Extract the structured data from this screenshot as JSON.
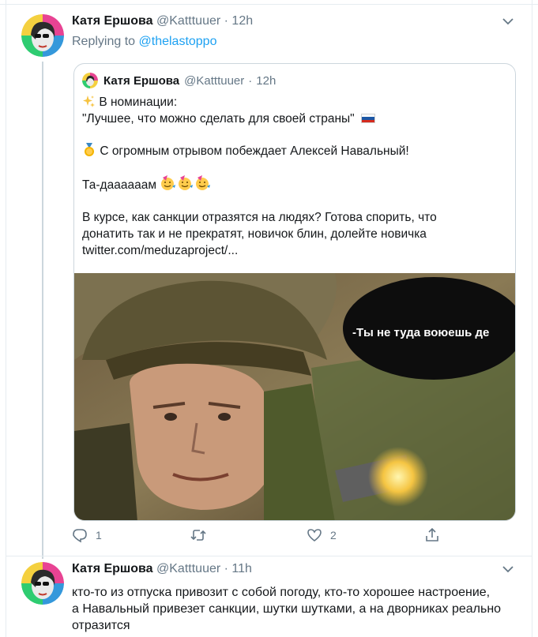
{
  "tweet1": {
    "author_name": "Катя Ершова",
    "author_handle": "@Katttuuer",
    "time": "12h",
    "replying_prefix": "Replying to",
    "replying_handle": "@thelastoppo",
    "quote": {
      "author_name": "Катя Ершова",
      "author_handle": "@Katttuuer",
      "time": "12h",
      "line1": "В номинации:",
      "line2": "\"Лучшее, что можно сделать для своей страны\"",
      "line3": "С огромным отрывом побеждает Алексей Навальный!",
      "line4": "Та-даааааам",
      "line5": "В курсе, как санкции отразятся на людях? Готова спорить, что",
      "line6": "донатить так и не прекратят, новичок блин, долейте новичка",
      "line7": "twitter.com/meduzaproject/...",
      "image_speech": "-Ты не туда воюешь де"
    },
    "actions": {
      "reply_count": "1",
      "retweet_count": "",
      "like_count": "2"
    }
  },
  "tweet2": {
    "author_name": "Катя Ершова",
    "author_handle": "@Katttuuer",
    "time": "11h",
    "text_line1": "кто-то из отпуска привозит с собой погоду, кто-то хорошее настроение,",
    "text_line2": "а Навальный привезет санкции, шутки шутками, а на дворниках реально",
    "text_line3": "отразится"
  },
  "colors": {
    "link": "#1da1f2",
    "muted": "#657786",
    "border": "#ccd6dd"
  },
  "icons": [
    "chevron-down-icon",
    "sparkles-icon",
    "russia-flag-icon",
    "medal-icon",
    "party-face-icon",
    "reply-icon",
    "retweet-icon",
    "like-icon",
    "share-icon"
  ]
}
